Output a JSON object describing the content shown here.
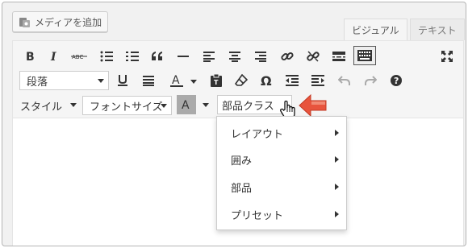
{
  "media_button": {
    "label": "メディアを追加",
    "icon": "media-add-icon"
  },
  "tabs": [
    {
      "label": "ビジュアル",
      "active": true
    },
    {
      "label": "テキスト",
      "active": false
    }
  ],
  "toolbar": {
    "format_select": {
      "value": "段落"
    },
    "style_select": {
      "value": "スタイル"
    },
    "font_size_select": {
      "value": "フォントサイズ"
    },
    "parts_class_button": {
      "label": "部品クラス"
    },
    "text_color_glyph": "A",
    "bg_color_glyph": "A"
  },
  "dropdown_menu": {
    "items": [
      {
        "label": "レイアウト"
      },
      {
        "label": "囲み"
      },
      {
        "label": "部品"
      },
      {
        "label": "プリセット"
      }
    ]
  },
  "colors": {
    "accent_arrow": "#e8543d",
    "toolbar_bg": "#f5f5f5"
  }
}
